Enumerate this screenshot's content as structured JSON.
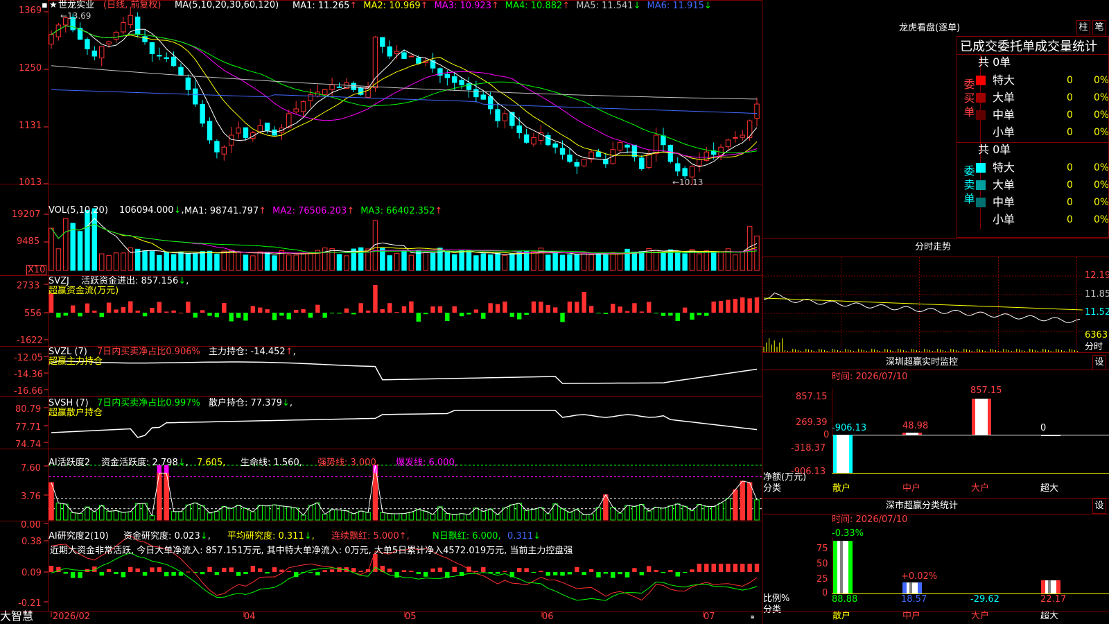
{
  "stock": {
    "name": "世龙实业",
    "period_label": "(日线, 前复权)",
    "star": "★"
  },
  "main": {
    "yticks": [
      "1369",
      "1250",
      "1131",
      "1013"
    ],
    "ma_params": "MA(5,10,20,30,60,120)",
    "ma": [
      {
        "label": "MA1: 11.265",
        "arrow": "↑",
        "color": "#ffffff"
      },
      {
        "label": "MA2: 10.969",
        "arrow": "↑",
        "color": "#ffff00"
      },
      {
        "label": "MA3: 10.923",
        "arrow": "↑",
        "color": "#ff00ff"
      },
      {
        "label": "MA4: 10.882",
        "arrow": "↑",
        "color": "#00ff00"
      },
      {
        "label": "MA5: 11.541",
        "arrow": "↓",
        "color": "#c0c0c0"
      },
      {
        "label": "MA6: 11.915",
        "arrow": "↓",
        "color": "#4169ff"
      }
    ],
    "high_label": "13.69",
    "low_label": "←10.13"
  },
  "vol": {
    "yticks": [
      "19207",
      "9485"
    ],
    "unit": "X10",
    "params": "VOL(5,10,20)",
    "value": "106094.000",
    "value_arrow": "↓",
    "ma": [
      {
        "label": "MA1: 98741.797",
        "arrow": "↑",
        "color": "#ffffff"
      },
      {
        "label": "MA2: 76506.203",
        "arrow": "↑",
        "color": "#ff00ff"
      },
      {
        "label": "MA3: 66402.352",
        "arrow": "↑",
        "color": "#00ff00"
      }
    ]
  },
  "svzj": {
    "yticks": [
      "2733",
      "556",
      "-1622"
    ],
    "name": "SVZJ",
    "line": "活跃资金进出: 857.156",
    "arrow": "↓",
    "sub": "超赢资金流(万元)"
  },
  "svzl": {
    "yticks": [
      "-12.05",
      "-14.36",
      "-16.66"
    ],
    "name": "SVZL (7)",
    "note": "7日内买卖净占比0.906%",
    "hold": "主力持仓: -14.452",
    "arrow": "↑",
    "sub": "超赢主力持仓"
  },
  "svsh": {
    "yticks": [
      "80.79",
      "77.71",
      "74.74"
    ],
    "name": "SVSH (7)",
    "note": "7日内买卖净占比0.997%",
    "hold": "散户持仓: 77.379",
    "arrow": "↓",
    "sub": "超赢散户持仓"
  },
  "ai1": {
    "yticks": [
      "7.60",
      "3.76",
      "0.00"
    ],
    "name": "AI活跃度2",
    "a": "资金活跃度: 2.798",
    "b": "7.605",
    "c": "生命线: 1.560,",
    "d": "强势线: 3.000,",
    "e": "爆发线: 6.000,"
  },
  "ai2": {
    "yticks": [
      "0.38",
      "0.09",
      "-0.21"
    ],
    "name": "AI研究度2(10)",
    "a": "资金研究度: 0.023",
    "b": "平均研究度: 0.311",
    "c": "连续飘红: 5.000",
    "d": "N日飘红: 6.000,",
    "e": "0.311",
    "comment": "近期大资金非常活跃, 今日大单净流入: 857.151万元, 其中特大单净流入: 0万元, 大单5日累计净入4572.019万元, 当前主力控盘强"
  },
  "xaxis": {
    "labels": [
      "2026/02",
      "04",
      "05",
      "06",
      "07"
    ],
    "brand": "大智慧"
  },
  "longhu": {
    "title": "龙虎看盘(逐单)",
    "btn1": "柱",
    "btn2": "笔",
    "header": "已成交委托单成交量统计",
    "buy": {
      "side": "委买单",
      "total": "共 0单",
      "rows": [
        {
          "name": "特大",
          "val": "0",
          "pct": "0%",
          "color": "#ff0000"
        },
        {
          "name": "大单",
          "val": "0",
          "pct": "0%",
          "color": "#a00000"
        },
        {
          "name": "中单",
          "val": "0",
          "pct": "0%",
          "color": "#600000"
        },
        {
          "name": "小单",
          "val": "0",
          "pct": "0%",
          "color": ""
        }
      ]
    },
    "sell": {
      "side": "委卖单",
      "total": "共 0单",
      "rows": [
        {
          "name": "特大",
          "val": "0",
          "pct": "0%",
          "color": "#00ffff"
        },
        {
          "name": "大单",
          "val": "0",
          "pct": "0%",
          "color": "#00a0a0"
        },
        {
          "name": "中单",
          "val": "0",
          "pct": "0%",
          "color": "#007070"
        },
        {
          "name": "小单",
          "val": "0",
          "pct": "0%",
          "color": ""
        }
      ]
    }
  },
  "intraday": {
    "title": "分时走势",
    "yticks": [
      "12.19",
      "11.85",
      "11.52"
    ],
    "vol_tick": "6363",
    "unit": "分时"
  },
  "sz_monitor": {
    "title": "深圳超赢实时监控",
    "btn": "设",
    "time": "时间: 2026/07/10",
    "yticks": [
      "857.15",
      "269.39",
      "0",
      "-318.37",
      "-906.13"
    ],
    "axis_label_1": "净额(万元)",
    "axis_label_2": "分类",
    "categories": [
      "散户",
      "中户",
      "大户",
      "超大"
    ],
    "values": [
      -906.13,
      48.98,
      857.15,
      0
    ],
    "value_labels": [
      "-906.13",
      "48.98",
      "857.15",
      "0"
    ]
  },
  "sz_class": {
    "title": "深市超赢分类统计",
    "btn": "设",
    "time": "时间: 2026/07/10",
    "yticks": [
      "75",
      "50",
      "25",
      "0"
    ],
    "axis_label_1": "比例%",
    "axis_label_2": "分类",
    "categories": [
      "散户",
      "中户",
      "大户",
      "超大"
    ],
    "values": [
      88.88,
      18.57,
      -29.62,
      22.17
    ],
    "change_labels": [
      "-0.33%",
      "+0.02%",
      "",
      ""
    ],
    "value_labels": [
      "88.88",
      "18.57",
      "-29.62",
      "22.17"
    ]
  },
  "chart_data": [
    {
      "type": "candlestick",
      "title": "世龙实业 (日线, 前复权)",
      "ylim": [
        10.13,
        13.69
      ],
      "x_labels": [
        "2026/02",
        "04",
        "05",
        "06",
        "07"
      ],
      "ohlc_close": [
        13.2,
        13.4,
        13.55,
        13.3,
        13.1,
        12.9,
        12.75,
        12.95,
        13.05,
        13.25,
        13.45,
        13.6,
        13.2,
        13.05,
        12.8,
        12.75,
        12.7,
        12.55,
        12.35,
        12.05,
        11.75,
        11.35,
        11.0,
        10.75,
        10.85,
        11.1,
        11.25,
        11.05,
        11.15,
        11.3,
        11.2,
        11.1,
        11.25,
        11.55,
        11.65,
        11.8,
        11.95,
        12.0,
        12.05,
        12.15,
        12.1,
        12.2,
        12.05,
        11.95,
        12.1,
        13.15,
        12.95,
        12.75,
        12.85,
        12.7,
        12.75,
        12.6,
        12.65,
        12.5,
        12.35,
        12.3,
        12.2,
        12.15,
        12.05,
        11.9,
        11.85,
        11.65,
        11.4,
        11.55,
        11.3,
        11.15,
        10.95,
        11.05,
        11.15,
        10.9,
        10.85,
        10.7,
        10.55,
        10.45,
        10.6,
        10.75,
        10.65,
        10.5,
        10.8,
        10.95,
        10.85,
        10.65,
        10.4,
        10.7,
        11.1,
        10.9,
        10.55,
        10.35,
        10.25,
        10.45,
        10.6,
        10.75,
        10.7,
        10.85,
        11.0,
        11.05,
        11.1,
        11.4,
        11.75
      ]
    },
    {
      "type": "bar",
      "title": "VOL(5,10,20)",
      "note": "bars in X10 units"
    },
    {
      "type": "bar",
      "title": "SVZJ 超赢资金流(万元)",
      "latest": 857.156
    },
    {
      "type": "line",
      "title": "SVZL 超赢主力持仓",
      "latest": -14.452
    },
    {
      "type": "line",
      "title": "SVSH 超赢散户持仓",
      "latest": 77.379
    },
    {
      "type": "bar",
      "title": "AI活跃度2",
      "latest": 2.798
    },
    {
      "type": "bar",
      "title": "AI研究度2(10)",
      "latest": 0.023
    },
    {
      "type": "bar",
      "title": "深圳超赢实时监控",
      "categories": [
        "散户",
        "中户",
        "大户",
        "超大"
      ],
      "values": [
        -906.13,
        48.98,
        857.15,
        0
      ]
    },
    {
      "type": "bar",
      "title": "深市超赢分类统计",
      "categories": [
        "散户",
        "中户",
        "大户",
        "超大"
      ],
      "values": [
        88.88,
        18.57,
        -29.62,
        22.17
      ]
    }
  ]
}
